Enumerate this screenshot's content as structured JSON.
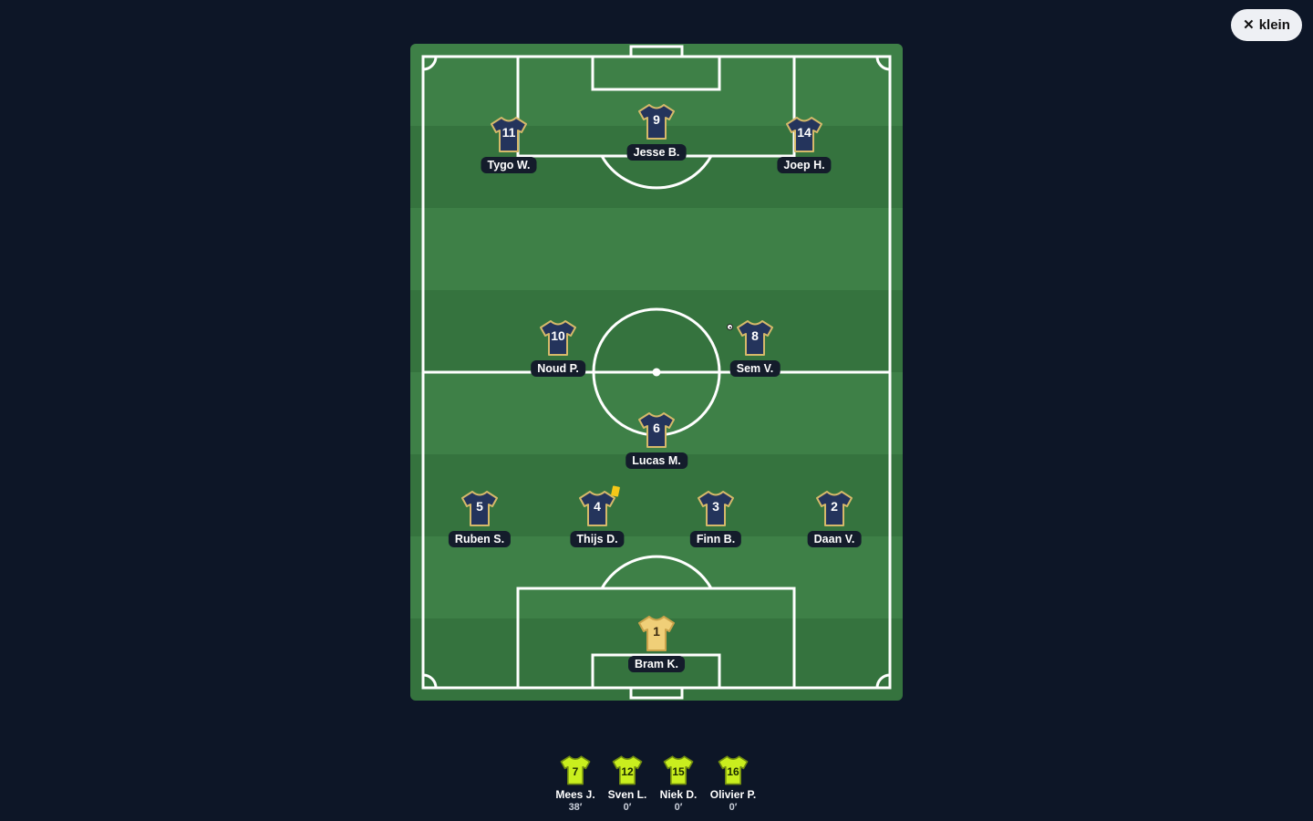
{
  "close_label": "klein",
  "close_icon": "x-icon",
  "colors": {
    "outfield_shirt": "#24345c",
    "outfield_trim": "#d6b96a",
    "keeper_shirt": "#f0cf78",
    "sub_shirt": "#c9ee1e",
    "pitch_light": "#3e8047",
    "pitch_dark": "#35733e",
    "background": "#0d1627"
  },
  "lineup": {
    "goalkeeper": {
      "number": "1",
      "name": "Bram K."
    },
    "defenders": [
      {
        "number": "5",
        "name": "Ruben S."
      },
      {
        "number": "4",
        "name": "Thijs D.",
        "yellow_card": true
      },
      {
        "number": "3",
        "name": "Finn B."
      },
      {
        "number": "2",
        "name": "Daan V."
      }
    ],
    "defensive_mid": {
      "number": "6",
      "name": "Lucas M."
    },
    "midfielders": [
      {
        "number": "10",
        "name": "Noud P."
      },
      {
        "number": "8",
        "name": "Sem V.",
        "scored_goal": true
      }
    ],
    "forwards": [
      {
        "number": "11",
        "name": "Tygo W."
      },
      {
        "number": "9",
        "name": "Jesse B."
      },
      {
        "number": "14",
        "name": "Joep H."
      }
    ]
  },
  "substitutes": [
    {
      "number": "7",
      "name": "Mees J.",
      "minutes": "38′"
    },
    {
      "number": "12",
      "name": "Sven L.",
      "minutes": "0′"
    },
    {
      "number": "15",
      "name": "Niek D.",
      "minutes": "0′"
    },
    {
      "number": "16",
      "name": "Olivier P.",
      "minutes": "0′"
    }
  ]
}
